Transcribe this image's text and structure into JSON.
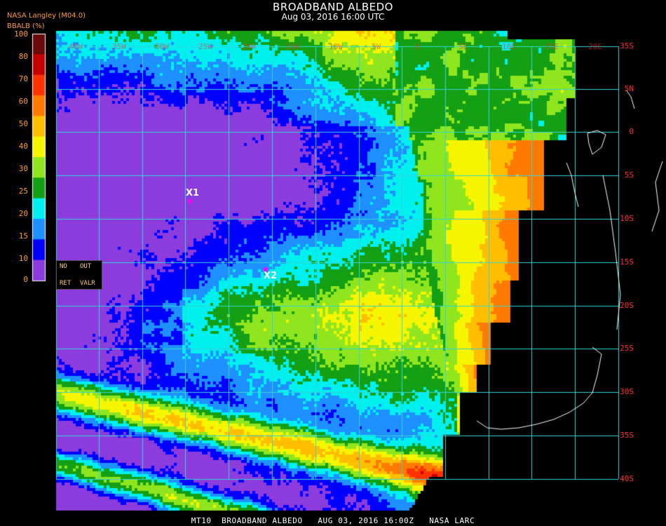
{
  "header": {
    "org": "NASA Langley (M04.0)",
    "title": "BROADBAND ALBEDO",
    "datetime": "Aug 03, 2016 16:00 UTC"
  },
  "colorbar": {
    "title": "BBALB (%)",
    "ticks": [
      "100",
      "80",
      "70",
      "60",
      "50",
      "40",
      "30",
      "25",
      "20",
      "15",
      "10",
      "0"
    ],
    "colors": [
      "#6a0a0a",
      "#c60000",
      "#ff3200",
      "#ff7a00",
      "#ffbe00",
      "#f5f500",
      "#90e61e",
      "#14a014",
      "#00f0f0",
      "#1e90ff",
      "#0000ff",
      "#8c3cdc"
    ]
  },
  "controls": {
    "no": "NO",
    "out": "OUT",
    "ret": "RET",
    "valr": "VALR"
  },
  "markers": [
    {
      "label": "X1"
    },
    {
      "label": "X2"
    }
  ],
  "lat_labels": [
    "35S",
    "5N",
    "0",
    "5S",
    "10S",
    "15S",
    "20S",
    "25S",
    "30S",
    "35S",
    "40S"
  ],
  "lon_labels": [
    "40W",
    "35W",
    "30W",
    "25W",
    "20W",
    "15W",
    "10W",
    "5W",
    "0",
    "5E",
    "10E",
    "15E",
    "20E",
    "25E",
    "30E",
    "35E"
  ],
  "footer": "MT10  BROADBAND ALBEDO   AUG 03, 2016 16:00Z   NASA LARC",
  "colors": {
    "grid": "#33d6d6",
    "label_red": "#ff2a2a",
    "label_orange": "#ff9c33",
    "coast": "#ffffff",
    "marker": "#ff00ff"
  }
}
